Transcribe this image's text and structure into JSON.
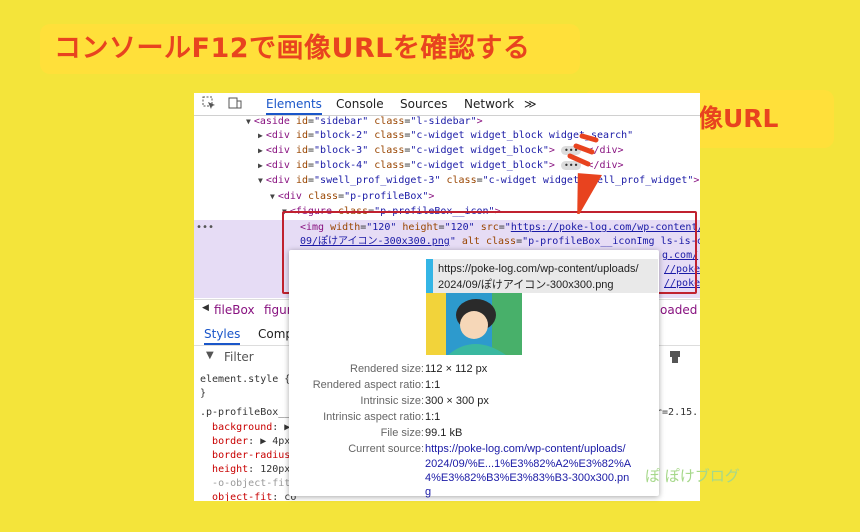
{
  "title_callout": "コンソールF12で画像URLを確認する",
  "url_callout": "これが画像URL",
  "devtools": {
    "tabs": [
      "Elements",
      "Console",
      "Sources",
      "Network"
    ],
    "more_tabs": "≫",
    "dom_lines": [
      {
        "html": "<span class='tri'>▼</span><span class='tag'>&lt;aside</span> <span class='attr'>id</span>=<span class='val'>\"sidebar\"</span> <span class='attr'>class</span>=<span class='val'>\"l-sidebar\"</span><span class='tag'>&gt;</span>"
      },
      {
        "html": "<span class='tri'>▶</span><span class='tag'>&lt;div</span> <span class='attr'>id</span>=<span class='val'>\"block-2\"</span> <span class='attr'>class</span>=<span class='val'>\"c-widget widget_block widget_search\"</span>"
      },
      {
        "html": "<span class='tri'>▶</span><span class='tag'>&lt;div</span> <span class='attr'>id</span>=<span class='val'>\"block-3\"</span> <span class='attr'>class</span>=<span class='val'>\"c-widget widget_block\"</span><span class='tag'>&gt;</span> <span class='ell'>•••</span> <span class='tag'>&lt;/div&gt;</span>"
      },
      {
        "html": "<span class='tri'>▶</span><span class='tag'>&lt;div</span> <span class='attr'>id</span>=<span class='val'>\"block-4\"</span> <span class='attr'>class</span>=<span class='val'>\"c-widget widget_block\"</span><span class='tag'>&gt;</span> <span class='ell'>•••</span> <span class='tag'>&lt;/div&gt;</span>"
      },
      {
        "html": "<span class='tri'>▼</span><span class='tag'>&lt;div</span> <span class='attr'>id</span>=<span class='val'>\"swell_prof_widget-3\"</span> <span class='attr'>class</span>=<span class='val'>\"c-widget widget_swell_prof_widget\"</span><span class='tag'>&gt;</span>"
      },
      {
        "html": "<span class='tri'>▼</span><span class='tag'>&lt;div</span> <span class='attr'>class</span>=<span class='val'>\"p-profileBox\"</span><span class='tag'>&gt;</span>"
      },
      {
        "html": "<span class='tri'>▼</span><span class='tag'>&lt;figure</span> <span class='attr'>class</span>=<span class='val'>\"p-profileBox__icon\"</span><span class='tag'>&gt;</span>"
      }
    ],
    "img_line1": "<span class='tag'>&lt;img</span> <span class='attr'>width</span>=<span class='val'>\"120\"</span> <span class='attr'>height</span>=<span class='val'>\"120\"</span> <span class='attr'>src</span>=<span class='val'>\"</span><span class='lnk'>https://poke-log.com/wp-content/uploads/20</span>",
    "img_line2": "<span class='lnk'>09/ぽけアイコン-300x300.png</span><span class='val'>\"</span> <span class='attr'>alt class</span>=<span class='val'>\"p-profileBox__iconImg ls-is-cached la</span>",
    "img_line3": "<span class='lnk'>g.com/</span>",
    "img_line4": "<span class='lnk'>//poke</span>",
    "img_line5": "<span class='lnk'>//poke</span>",
    "breadcrumb_left": "fileBox",
    "breadcrumb_mid": "figur",
    "breadcrumb_right": "oaded",
    "styles_tab": "Styles",
    "computed_tab": "Comp",
    "filter_label": "Filter",
    "css_lines": [
      {
        "html": "element.style {"
      },
      {
        "html": "}"
      },
      {
        "html": ".p-profileBox__ico"
      },
      {
        "html": "&nbsp;&nbsp;<span class='prop'>background</span>: ▶"
      },
      {
        "html": "&nbsp;&nbsp;<span class='prop'>border</span>: ▶ 4px"
      },
      {
        "html": "&nbsp;&nbsp;<span class='prop'>border-radius</span>:"
      },
      {
        "html": "&nbsp;&nbsp;<span class='prop'>height</span>: 120px;"
      },
      {
        "html": "&nbsp;&nbsp;<span style='color:#999'>-o-object-fit:</span>"
      },
      {
        "html": "&nbsp;&nbsp;<span class='prop'>object-fit</span>: co"
      }
    ],
    "right_ver": "er=2.15."
  },
  "tooltip": {
    "url_line1": "https://poke-log.com/wp-content/uploads/",
    "url_line2": "2024/09/ぽけアイコン-300x300.png",
    "rows": [
      {
        "label": "Rendered size:",
        "value": "112 × 112 px"
      },
      {
        "label": "Rendered aspect ratio:",
        "value": "1:1"
      },
      {
        "label": "Intrinsic size:",
        "value": "300 × 300 px"
      },
      {
        "label": "Intrinsic aspect ratio:",
        "value": "1:1"
      },
      {
        "label": "File size:",
        "value": "99.1 kB"
      },
      {
        "label": "Current source:",
        "value": "https://poke-log.com/wp-content/uploads/"
      }
    ],
    "source_cont": [
      "2024/09/%E...1%E3%82%A2%E3%82%A",
      "4%E3%82%B3%E3%83%B3-300x300.pn",
      "g"
    ]
  },
  "watermark": "ぽ ぽけブログ",
  "colors": {
    "accent": "#e8431f",
    "callout": "#ffe03a",
    "background": "#f4e43a",
    "highlight": "#c0212f"
  }
}
